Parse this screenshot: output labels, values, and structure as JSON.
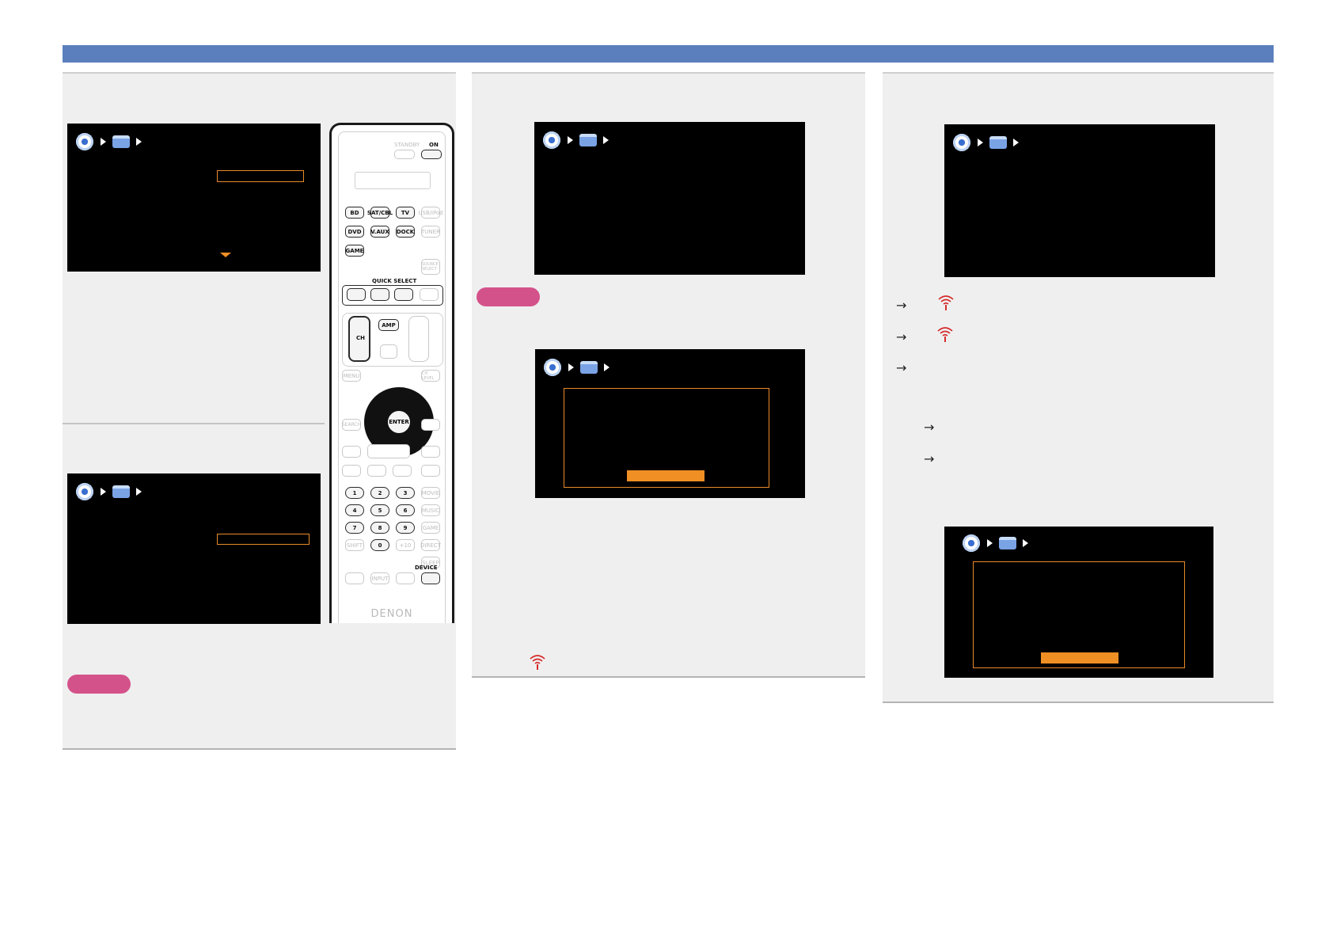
{
  "header": {
    "bar_color": "#5b7fbd"
  },
  "colors": {
    "panel": "#efefef",
    "screen": "#000000",
    "accent": "#ef8f24",
    "note_badge": "#d4528a",
    "wifi": "#d62b2b"
  },
  "breadcrumb_icons": [
    "gear-icon",
    "triangle-right-icon",
    "toolbox-icon",
    "triangle-right-icon"
  ],
  "remote": {
    "standby_label": "STANDBY",
    "on_label": "ON",
    "source_buttons": [
      "BD",
      "SAT/CBL",
      "TV",
      "USB/iPod",
      "DVD",
      "V.AUX",
      "DOCK",
      "TUNER",
      "GAME"
    ],
    "source_select_label": "SOURCE SELECT",
    "quick_select_label": "QUICK SELECT",
    "ch_label": "CH",
    "amp_label": "AMP",
    "menu_label": "MENU",
    "ch_level_label": "CH LEVEL",
    "enter_label": "ENTER",
    "search_label": "SEARCH",
    "number_buttons": [
      "1",
      "2",
      "3",
      "4",
      "5",
      "6",
      "7",
      "8",
      "9",
      "0"
    ],
    "right_column_buttons": [
      "MOVIE",
      "MUSIC",
      "GAME",
      "DIRECT",
      "SLEEP"
    ],
    "shift_label": "SHIFT",
    "plus10_label": "+10",
    "input_label": "INPUT",
    "device_label": "DEVICE",
    "brand": "DENON"
  },
  "wifi_icons": [
    "wifi-icon",
    "wifi-icon",
    "wifi-icon"
  ]
}
